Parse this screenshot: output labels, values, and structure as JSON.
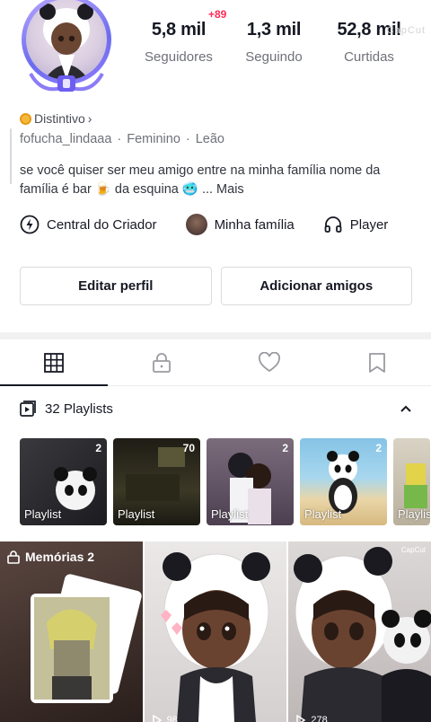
{
  "profile": {
    "badge_plus": "+89",
    "watermark": "CapCut"
  },
  "stats": [
    {
      "value": "5,8 mil",
      "label": "Seguidores"
    },
    {
      "value": "1,3 mil",
      "label": "Seguindo"
    },
    {
      "value": "52,8 mil",
      "label": "Curtidas"
    }
  ],
  "distintivo": {
    "label": "Distintivo",
    "chevron": "›"
  },
  "meta": {
    "username": "fofucha_lindaaa",
    "gender": "Feminino",
    "sign": "Leão",
    "separator": "·"
  },
  "bio": {
    "text": "se você quiser ser meu amigo entre na minha família nome da família é bar 🍺 da esquina 🥶 ...",
    "more": "Mais"
  },
  "links": {
    "creator": "Central do Criador",
    "family": "Minha família",
    "player": "Player"
  },
  "buttons": {
    "edit": "Editar perfil",
    "add_friends": "Adicionar amigos"
  },
  "tabs": [
    {
      "icon": "grid-icon",
      "active": true
    },
    {
      "icon": "lock-icon",
      "active": false
    },
    {
      "icon": "heart-icon",
      "active": false
    },
    {
      "icon": "bookmark-icon",
      "active": false
    }
  ],
  "playlists": {
    "header": "32 Playlists",
    "items": [
      {
        "label": "Playlist",
        "count": "2",
        "color": "#2b2a2e"
      },
      {
        "label": "Playlist",
        "count": "70",
        "color": "#2f2c1f"
      },
      {
        "label": "Playlist",
        "count": "2",
        "color": "#6a5a6e"
      },
      {
        "label": "Playlist",
        "count": "2",
        "color": "#7fb6d8"
      },
      {
        "label": "Playlis",
        "count": "",
        "color": "#c8c2b4"
      }
    ]
  },
  "videos": [
    {
      "label": "Memórias 2",
      "views": "",
      "color": "#4a3a36"
    },
    {
      "label": "",
      "views": "98",
      "color": "#e7e3e2"
    },
    {
      "label": "",
      "views": "278",
      "color": "#cfc9c8",
      "watermark": "CapCut"
    }
  ],
  "colors": {
    "accent": "#fe2c55",
    "text": "#161823",
    "muted": "#6f7179"
  }
}
